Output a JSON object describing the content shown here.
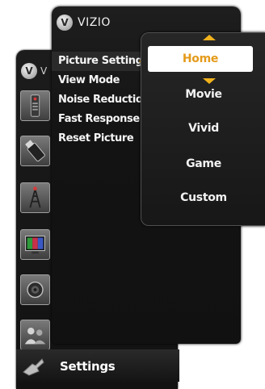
{
  "brand": "VIZIO",
  "logo_letter": "V",
  "back_panel": {
    "truncated_title": "V",
    "icons": [
      "remote-icon",
      "usb-stick-icon",
      "antenna-tower-icon",
      "color-tv-icon",
      "speaker-icon",
      "people-icon"
    ],
    "footer_label": "Settings",
    "footer_icon": "settings-wrench-icon"
  },
  "menu": {
    "items": [
      {
        "label": "Picture Setting",
        "selected": true
      },
      {
        "label": "View Mode",
        "selected": false
      },
      {
        "label": "Noise Reduction",
        "selected": false
      },
      {
        "label": "Fast Response",
        "selected": false
      },
      {
        "label": "Reset Picture",
        "selected": false
      }
    ]
  },
  "submenu": {
    "options": [
      {
        "label": "Home",
        "selected": true
      },
      {
        "label": "Movie",
        "selected": false
      },
      {
        "label": "Vivid",
        "selected": false
      },
      {
        "label": "Game",
        "selected": false
      },
      {
        "label": "Custom",
        "selected": false
      }
    ]
  },
  "colors": {
    "accent": "#f1b21c",
    "selected_text": "#e49a1a",
    "panel_bg": "#151515",
    "text": "#f4f4f4"
  }
}
